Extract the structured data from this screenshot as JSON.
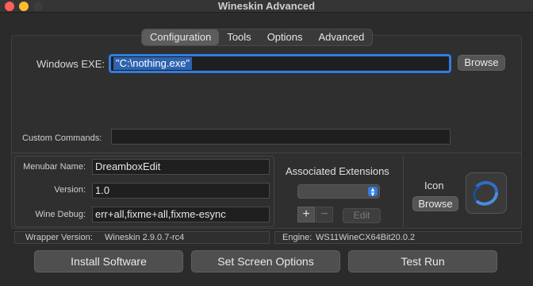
{
  "window": {
    "title": "Wineskin Advanced"
  },
  "tabs": [
    {
      "label": "Configuration"
    },
    {
      "label": "Tools"
    },
    {
      "label": "Options"
    },
    {
      "label": "Advanced"
    }
  ],
  "config": {
    "exe_label": "Windows EXE:",
    "exe_value": "\"C:\\nothing.exe\"",
    "exe_browse": "Browse",
    "custom_commands_label": "Custom Commands:",
    "custom_commands_value": "",
    "menubar_label": "Menubar Name:",
    "menubar_value": "DreamboxEdit",
    "version_label": "Version:",
    "version_value": "1.0",
    "winedebug_label": "Wine Debug:",
    "winedebug_value": "err+all,fixme+all,fixme-esync"
  },
  "extensions": {
    "title": "Associated Extensions",
    "add": "+",
    "remove": "−",
    "edit": "Edit"
  },
  "icon": {
    "label": "Icon",
    "browse": "Browse"
  },
  "status": {
    "wrapper_label": "Wrapper Version:",
    "wrapper_value": "Wineskin 2.9.0.7-rc4",
    "engine_label": "Engine:",
    "engine_value": "WS11WineCX64Bit20.0.2"
  },
  "buttons": {
    "install": "Install Software",
    "screen": "Set Screen Options",
    "test": "Test Run"
  },
  "colors": {
    "accent": "#2f7de1",
    "close": "#ff5f57",
    "minimize": "#febc2e",
    "zoom": "#28c840"
  }
}
